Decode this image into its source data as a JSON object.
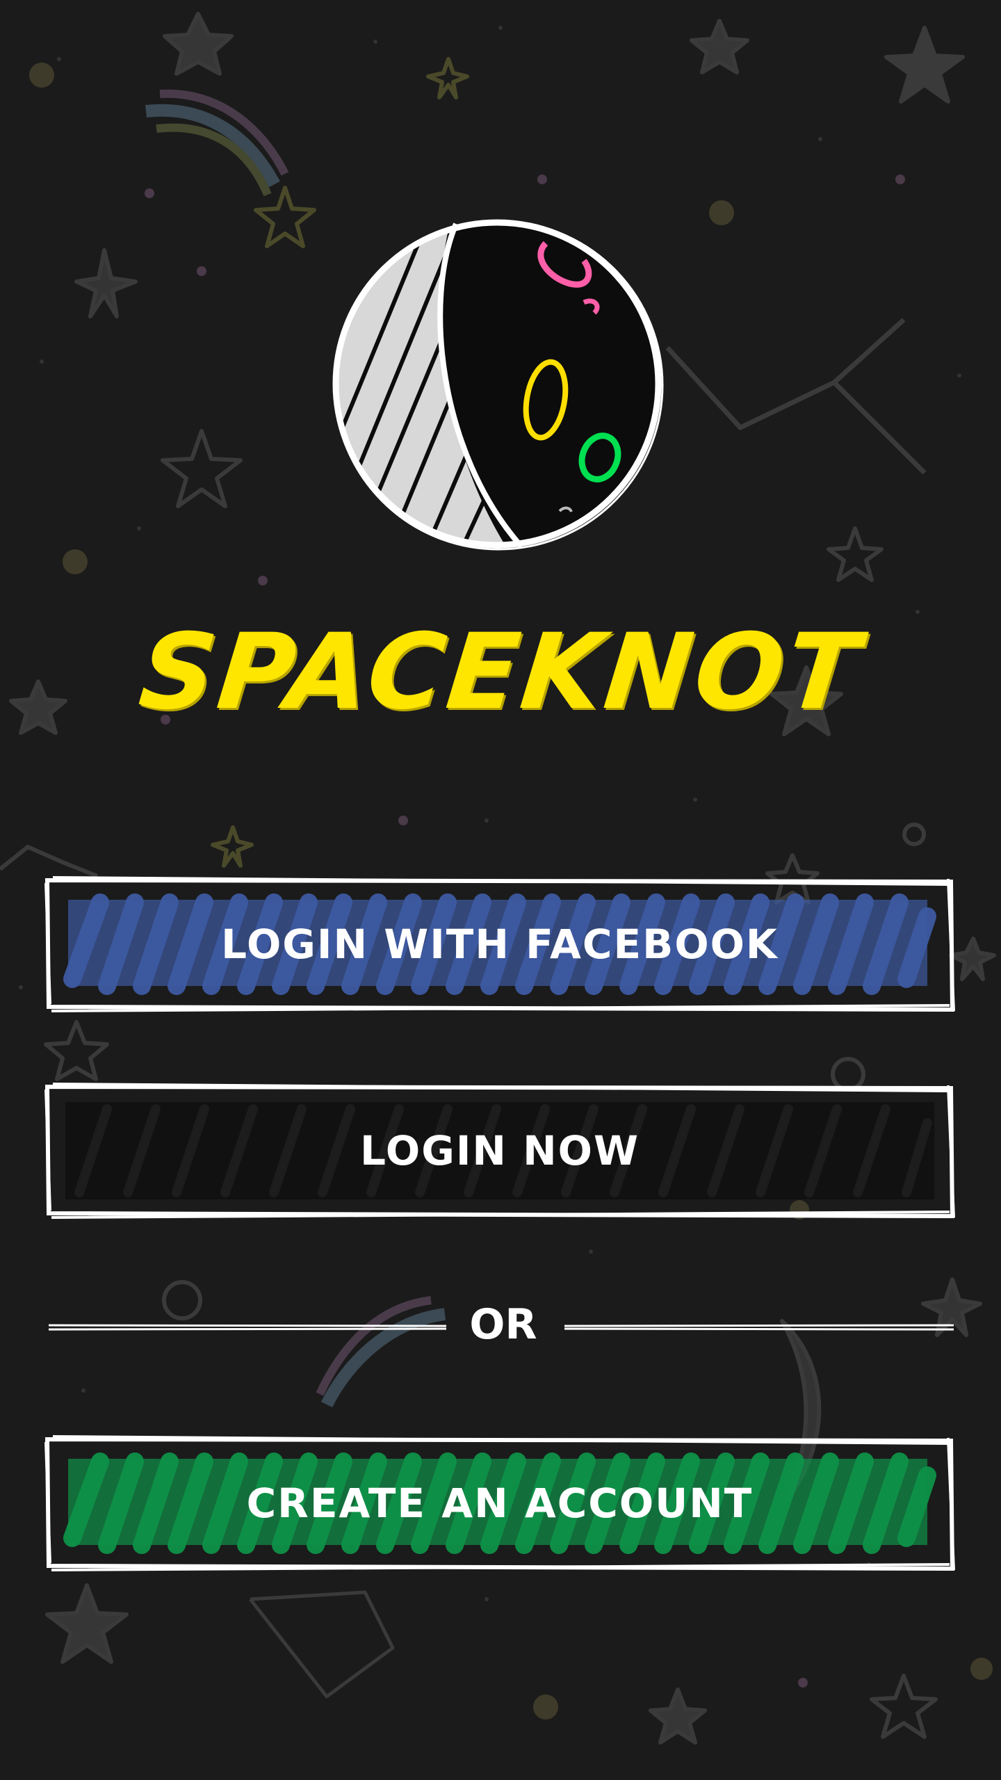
{
  "app": {
    "title": "SPACEKNOT",
    "title_color": "#ffe600",
    "background_color": "#1b1b1b"
  },
  "logo": {
    "name": "moon-logo-icon"
  },
  "buttons": {
    "facebook": {
      "label": "LOGIN WITH FACEBOOK",
      "fill_color": "#3d5aa1"
    },
    "login": {
      "label": "LOGIN NOW",
      "fill_color": "#111111"
    },
    "create": {
      "label": "CREATE AN ACCOUNT",
      "fill_color": "#0e9148"
    }
  },
  "divider": {
    "text": "OR"
  },
  "icons": [
    "star-icon",
    "constellation-icon",
    "shooting-star-icon",
    "planet-dot-icon",
    "moon-logo-icon"
  ]
}
